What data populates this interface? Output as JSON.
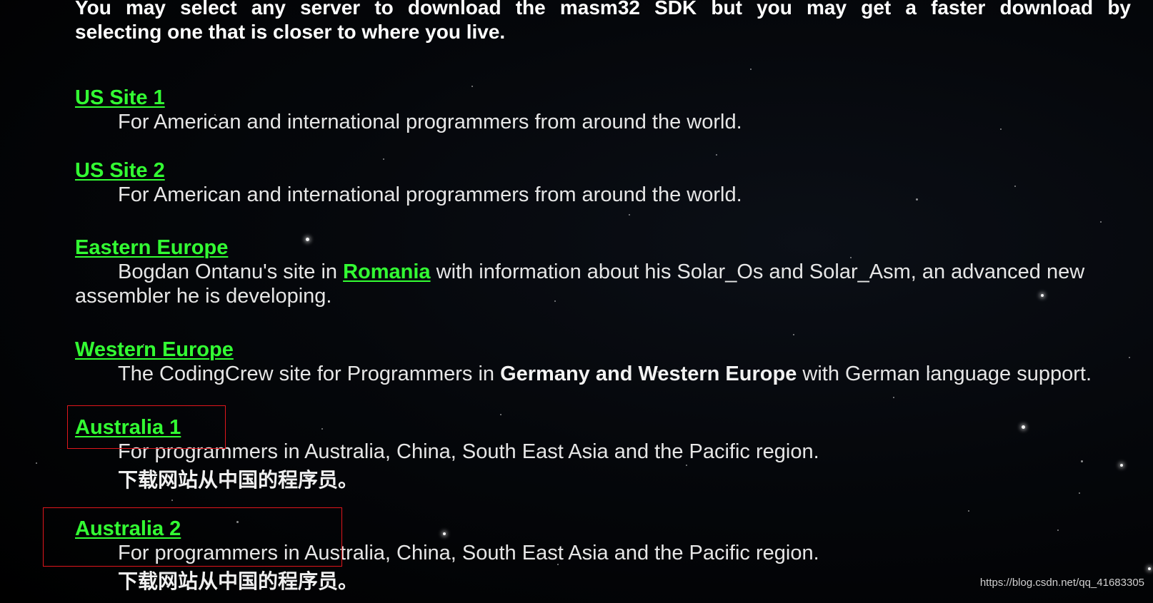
{
  "intro": {
    "line1": "You may select any server to download the masm32 SDK but you may get a faster download by",
    "line2": "selecting one that is closer to where you live."
  },
  "sites": [
    {
      "link": "US Site 1",
      "desc": "For American and international programmers from around the world."
    },
    {
      "link": "US Site 2",
      "desc": "For American and international programmers from around the world."
    },
    {
      "link": "Eastern Europe",
      "desc_before": "Bogdan Ontanu's site in ",
      "desc_link": "Romania",
      "desc_after": " with information about his Solar_Os and Solar_Asm, an advanced new",
      "desc_cont": "assembler he is developing."
    },
    {
      "link": "Western Europe",
      "desc_before": "The CodingCrew site for Programmers in ",
      "desc_bold": "Germany and Western Europe",
      "desc_after": " with German language support."
    },
    {
      "link": "Australia 1",
      "desc": "For programmers in Australia, China, South East Asia and the Pacific region.",
      "cn": "下载网站从中国的程序员。"
    },
    {
      "link": "Australia 2",
      "desc": "For programmers in Australia, China, South East Asia and the Pacific region.",
      "cn": "下载网站从中国的程序员。"
    }
  ],
  "watermark": "https://blog.csdn.net/qq_41683305",
  "colors": {
    "link": "#33ff33",
    "highlight": "#e0161c",
    "background": "#000000"
  }
}
